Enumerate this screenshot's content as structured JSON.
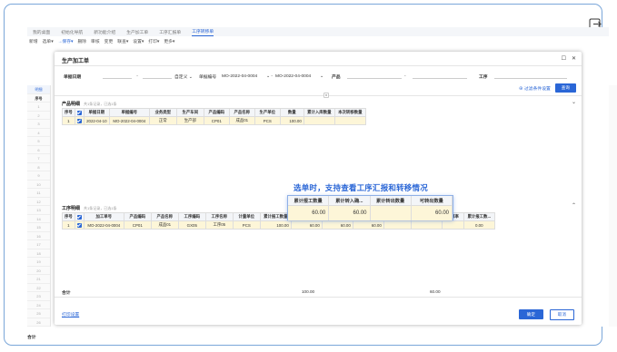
{
  "tabs": [
    "我的桌面",
    "初始化导航",
    "新功能介绍",
    "生产加工单",
    "工序汇报单",
    "工序转移单"
  ],
  "active_tab": 5,
  "toolbar": [
    "新增",
    "选单▾",
    "→保存▾",
    "删除",
    "审核",
    "变更",
    "联查▾",
    "设置▾",
    "打印▾",
    "更多▾"
  ],
  "bg_rows": [
    "1",
    "2",
    "3",
    "4",
    "5",
    "6",
    "7",
    "8",
    "9",
    "10",
    "11",
    "12",
    "13",
    "14",
    "15",
    "16",
    "17",
    "18",
    "19",
    "20",
    "21",
    "22",
    "23",
    "24",
    "25",
    "26"
  ],
  "bg_header": {
    "tab": "明细",
    "seq": "序号"
  },
  "bg_total": "合计",
  "modal": {
    "title": "生产加工单",
    "filter": {
      "date_label": "单据日期",
      "date_sep": "-",
      "custom": "自定义",
      "no_label": "单据编号",
      "no_from": "MO-2022-04-0004",
      "no_to": "MO-2022-04-0004",
      "product_label": "产品",
      "product_sep": "-",
      "process_label": "工序"
    },
    "filter_settings": "过滤条件设置",
    "query": "查询",
    "section1": {
      "title": "产品明细",
      "sub": "共1条记录，已选1条",
      "headers": [
        "序号",
        "☑",
        "单据日期",
        "单据编号",
        "业务类型",
        "生产车间",
        "产品编码",
        "产品名称",
        "生产单位",
        "数量",
        "累计入库数量",
        "本次转移数量"
      ],
      "rows": [
        [
          "1",
          "",
          "2022-04-10",
          "MO-2022-04-0004",
          "正常",
          "生产部",
          "CP01",
          "成品01",
          "PCS",
          "100.00",
          "",
          ""
        ]
      ]
    },
    "section2": {
      "title": "工序明细",
      "sub": "共1条记录，已选1条",
      "headers": [
        "序号",
        "☑",
        "加工单号",
        "产品编码",
        "产品名称",
        "工序编码",
        "工序名称",
        "计量单位",
        "累计报工数量",
        "累计转入确...",
        "累计转出数量",
        "可转出数量",
        "计件单位",
        "计价计件单位",
        "换算率",
        "累计报工数..."
      ],
      "rows": [
        [
          "1",
          "",
          "MO-2022-04-0004",
          "CP01",
          "成品01",
          "GX05",
          "工序05",
          "PCS",
          "100.00",
          "60.00",
          "60.00",
          "60.00",
          "",
          "",
          "",
          "0.00"
        ]
      ],
      "total_label": "合计",
      "total_qty": "100.00",
      "total_out": "60.00"
    },
    "print_settings": "打印设置",
    "ok": "确定",
    "cancel": "取消"
  },
  "callout": {
    "text": "选单时，支持查看工序汇报和转移情况",
    "headers": [
      "累计报工数量",
      "累计转入确...",
      "累计转出数量",
      "可转出数量"
    ],
    "values": [
      "60.00",
      "60.00",
      "",
      "60.00"
    ]
  },
  "colors": {
    "accent": "#2a66d6",
    "highlight_row": "#fdf6d8"
  }
}
